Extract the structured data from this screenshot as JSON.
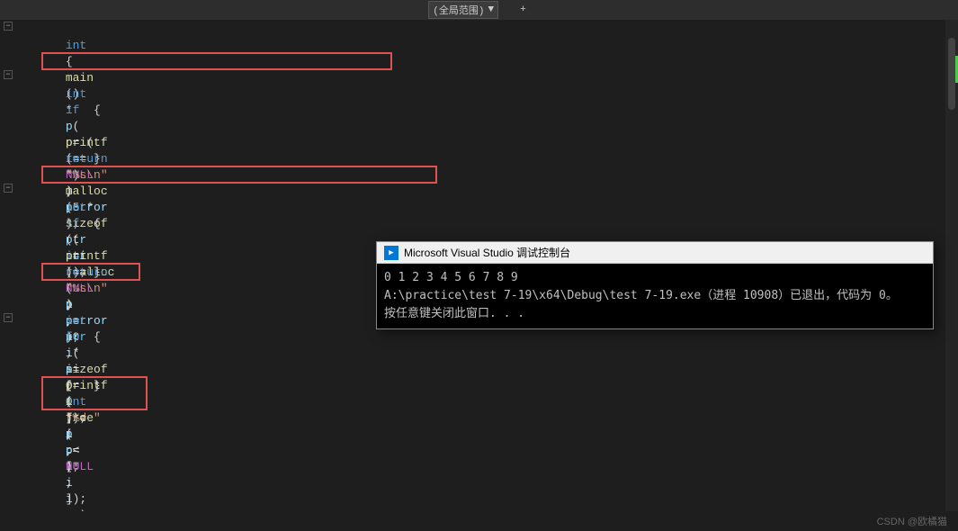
{
  "topbar": {
    "dropdown1_label": "(全局范围)",
    "add_btn": "+"
  },
  "editor": {
    "lines": [
      {
        "num": "",
        "text": "int main()",
        "indent": 0
      },
      {
        "num": "",
        "text": "{",
        "indent": 0
      },
      {
        "num": "",
        "text": "    int* p = (int*)malloc(5 * sizeof(int));",
        "indent": 4,
        "box": "malloc-box"
      },
      {
        "num": "",
        "text": "    if (p == NULL)",
        "indent": 4
      },
      {
        "num": "",
        "text": "    {",
        "indent": 4
      },
      {
        "num": "",
        "text": "        printf(\"%s\\n\", perror);",
        "indent": 8
      },
      {
        "num": "",
        "text": "        return 1;",
        "indent": 8
      },
      {
        "num": "",
        "text": "    }",
        "indent": 4
      },
      {
        "num": "",
        "text": "",
        "indent": 0
      },
      {
        "num": "",
        "text": "    int* ptr = realloc(p, 10 * sizeof(int));",
        "indent": 4,
        "box": "realloc-box"
      },
      {
        "num": "",
        "text": "    if (ptr == NULL)",
        "indent": 4
      },
      {
        "num": "",
        "text": "    {",
        "indent": 4
      },
      {
        "num": "",
        "text": "        printf(\"%s\\n\", perror);",
        "indent": 8
      },
      {
        "num": "",
        "text": "        return 1;",
        "indent": 8
      },
      {
        "num": "",
        "text": "    }",
        "indent": 4
      },
      {
        "num": "",
        "text": "    p = ptr;",
        "indent": 4,
        "box": "ptr-box"
      },
      {
        "num": "",
        "text": "    int i = 0;",
        "indent": 4
      },
      {
        "num": "",
        "text": "    for (i = 0; i < 10; i++)",
        "indent": 4
      },
      {
        "num": "",
        "text": "    {",
        "indent": 4
      },
      {
        "num": "",
        "text": "        p[i] = i;",
        "indent": 8
      },
      {
        "num": "",
        "text": "        printf(\"%d \", p[i]);",
        "indent": 8
      },
      {
        "num": "",
        "text": "    }",
        "indent": 4
      },
      {
        "num": "",
        "text": "    free(p);",
        "indent": 4,
        "box": "free-box"
      },
      {
        "num": "",
        "text": "    p = NULL;",
        "indent": 4,
        "box": "free-box"
      },
      {
        "num": "",
        "text": "",
        "indent": 0
      }
    ]
  },
  "console": {
    "titlebar": "Microsoft Visual Studio 调试控制台",
    "output_line1": "0 1 2 3 4 5 6 7 8 9",
    "output_line2": "A:\\practice\\test 7-19\\x64\\Debug\\test 7-19.exe（进程 10908）已退出，代码为 0。",
    "output_line3": "按任意键关闭此窗口. . ."
  },
  "bottombar": {
    "watermark": "CSDN @欧橘猫"
  }
}
